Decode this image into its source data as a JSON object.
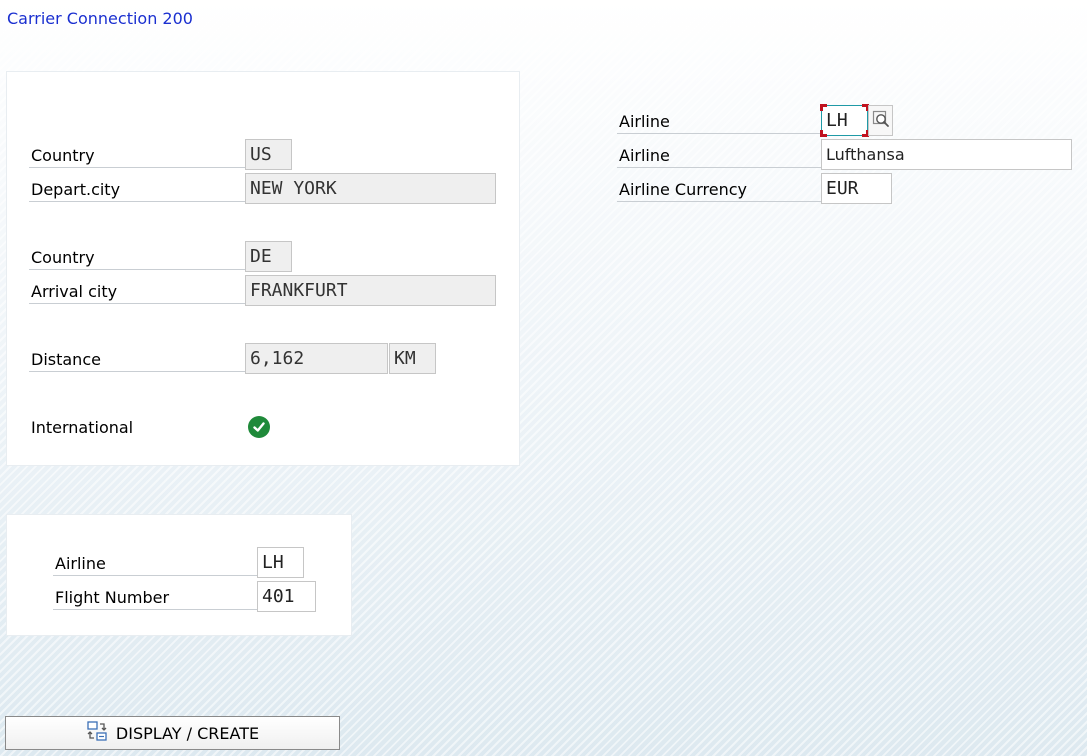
{
  "screen": {
    "title": "Carrier Connection 200"
  },
  "route": {
    "departure": {
      "country_label": "Country",
      "country": "US",
      "city_label": "Depart.city",
      "city": "NEW YORK"
    },
    "arrival": {
      "country_label": "Country",
      "country": "DE",
      "city_label": "Arrival city",
      "city": "FRANKFURT"
    },
    "distance_label": "Distance",
    "distance": "6,162",
    "distance_unit": "KM",
    "international_label": "International",
    "international": true
  },
  "carrier": {
    "airline_code_label": "Airline",
    "airline_code": "LH",
    "airline_name_label": "Airline",
    "airline_name": "Lufthansa",
    "currency_label": "Airline Currency",
    "currency": "EUR"
  },
  "flight_key": {
    "airline_label": "Airline",
    "airline": "LH",
    "flight_number_label": "Flight Number",
    "flight_number": "401"
  },
  "actions": {
    "display_create": "DISPLAY / CREATE"
  },
  "icons": {
    "international": "check-circle-icon",
    "value_help": "search-help-icon",
    "display_create": "toggle-display-change-icon"
  },
  "colors": {
    "title": "#1a2fd0",
    "check": "#1f8a3a",
    "focus_corner": "#c1121f",
    "focus_border": "#1f9aa6"
  }
}
